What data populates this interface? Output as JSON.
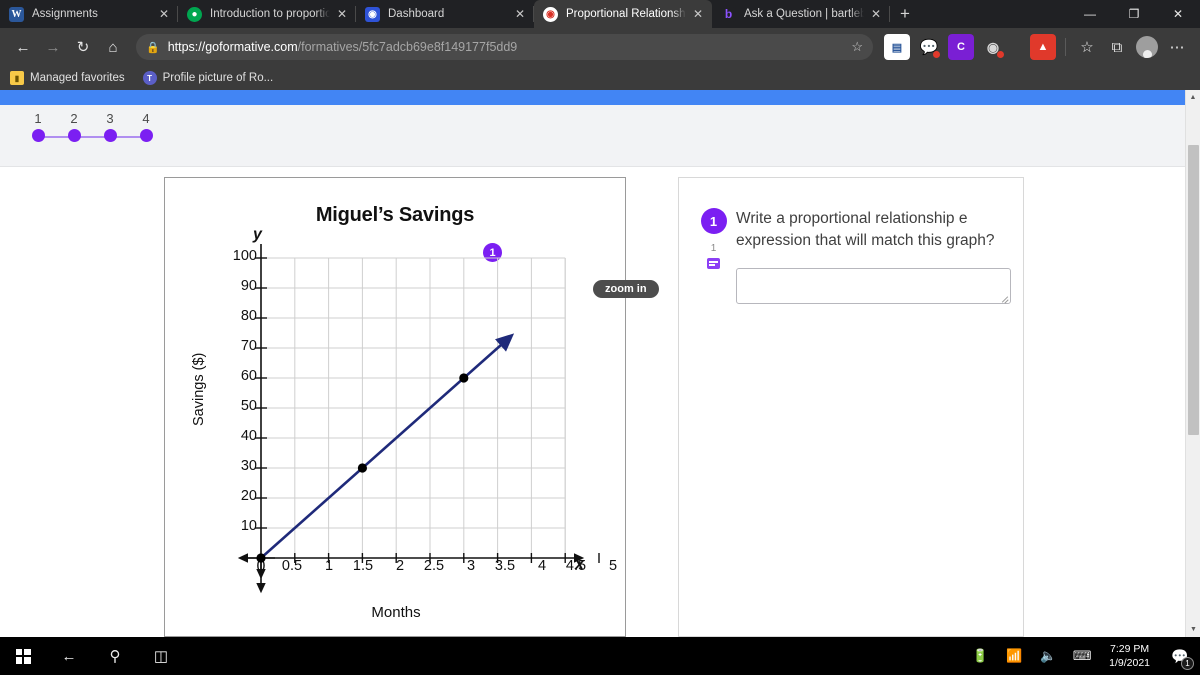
{
  "browser": {
    "tabs": [
      {
        "title": "Assignments",
        "favicon": "word-icon",
        "active": false
      },
      {
        "title": "Introduction to proportional re",
        "favicon": "green-shield-icon",
        "active": false
      },
      {
        "title": "Dashboard",
        "favicon": "blue-app-icon",
        "active": false
      },
      {
        "title": "Proportional Relationship Equa",
        "favicon": "chrome-icon",
        "active": true
      },
      {
        "title": "Ask a Question | bartleby",
        "favicon": "bartleby-icon",
        "active": false
      }
    ],
    "new_tab_label": "+",
    "window_controls": {
      "minimize": "—",
      "maximize": "❐",
      "close": "✕"
    },
    "nav": {
      "back": "←",
      "forward": "→",
      "reload": "↻",
      "home": "⌂"
    },
    "address": {
      "lock_icon": "lock-icon",
      "scheme": "https://",
      "host": "goformative.com",
      "path": "/formatives/5fc7adcb69e8f149177f5dd9",
      "full": "https://goformative.com/formatives/5fc7adcb69e8f149177f5dd9"
    },
    "extensions": [
      {
        "name": "office-extension",
        "label": "O"
      },
      {
        "name": "bubble-extension",
        "label": "◯"
      },
      {
        "name": "c-extension",
        "label": "C"
      },
      {
        "name": "circle-extension",
        "label": "◉"
      },
      {
        "name": "adobe-acrobat-extension",
        "label": "A"
      }
    ],
    "toolbar_right": {
      "favorites": "☆",
      "collections": "⧉",
      "profile": "profile-icon",
      "settings": "⋯"
    },
    "favorites_bar": [
      {
        "label": "Managed favorites",
        "icon": "folder-icon"
      },
      {
        "label": "Profile picture of Ro...",
        "icon": "teams-icon"
      }
    ]
  },
  "page": {
    "pagination": {
      "numbers": [
        "1",
        "2",
        "3",
        "4"
      ],
      "active_index": 0
    },
    "tooltip": "zoom in",
    "graph_badge": "1"
  },
  "question": {
    "number": "1",
    "points": "1",
    "text": "Write a proportional relationship e expression that will match this graph?",
    "answer_value": "",
    "answer_placeholder": ""
  },
  "chart_data": {
    "type": "line",
    "title": "Miguel’s Savings",
    "xlabel": "Months",
    "ylabel": "Savings ($)",
    "x_axis_letter": "x",
    "y_axis_letter": "y",
    "xlim": [
      0,
      5.5
    ],
    "ylim": [
      0,
      105
    ],
    "x_ticks": [
      "0",
      "0.5",
      "1",
      "1.5",
      "2",
      "2.5",
      "3",
      "3.5",
      "4",
      "4.5",
      "5"
    ],
    "x_tick_values": [
      0,
      0.5,
      1,
      1.5,
      2,
      2.5,
      3,
      3.5,
      4,
      4.5,
      5
    ],
    "y_ticks": [
      "10",
      "20",
      "30",
      "40",
      "50",
      "60",
      "70",
      "80",
      "90",
      "100"
    ],
    "y_tick_values": [
      10,
      20,
      30,
      40,
      50,
      60,
      70,
      80,
      90,
      100
    ],
    "origin_label": "0",
    "grid": true,
    "legend": false,
    "line_color": "#1f2a7a",
    "series": [
      {
        "name": "Savings",
        "slope": 20,
        "x": [
          0,
          3.6
        ],
        "y": [
          0,
          72
        ],
        "points": [
          {
            "x": 0,
            "y": 0
          },
          {
            "x": 1.5,
            "y": 30
          },
          {
            "x": 3,
            "y": 60
          }
        ],
        "arrow_end": true
      }
    ]
  },
  "taskbar": {
    "start": "start-icon",
    "back": "←",
    "search": "search-icon",
    "taskview": "taskview-icon",
    "tray": [
      "battery-icon",
      "wifi-icon",
      "volume-icon",
      "keyboard-icon"
    ],
    "time": "7:29 PM",
    "date": "1/9/2021",
    "notification_count": "1"
  },
  "colors": {
    "accent_purple": "#7b1ff2",
    "header_blue": "#4285f4",
    "line_navy": "#1f2a7a",
    "chrome_dark": "#3b3b3b",
    "tabstrip_dark": "#202124"
  }
}
